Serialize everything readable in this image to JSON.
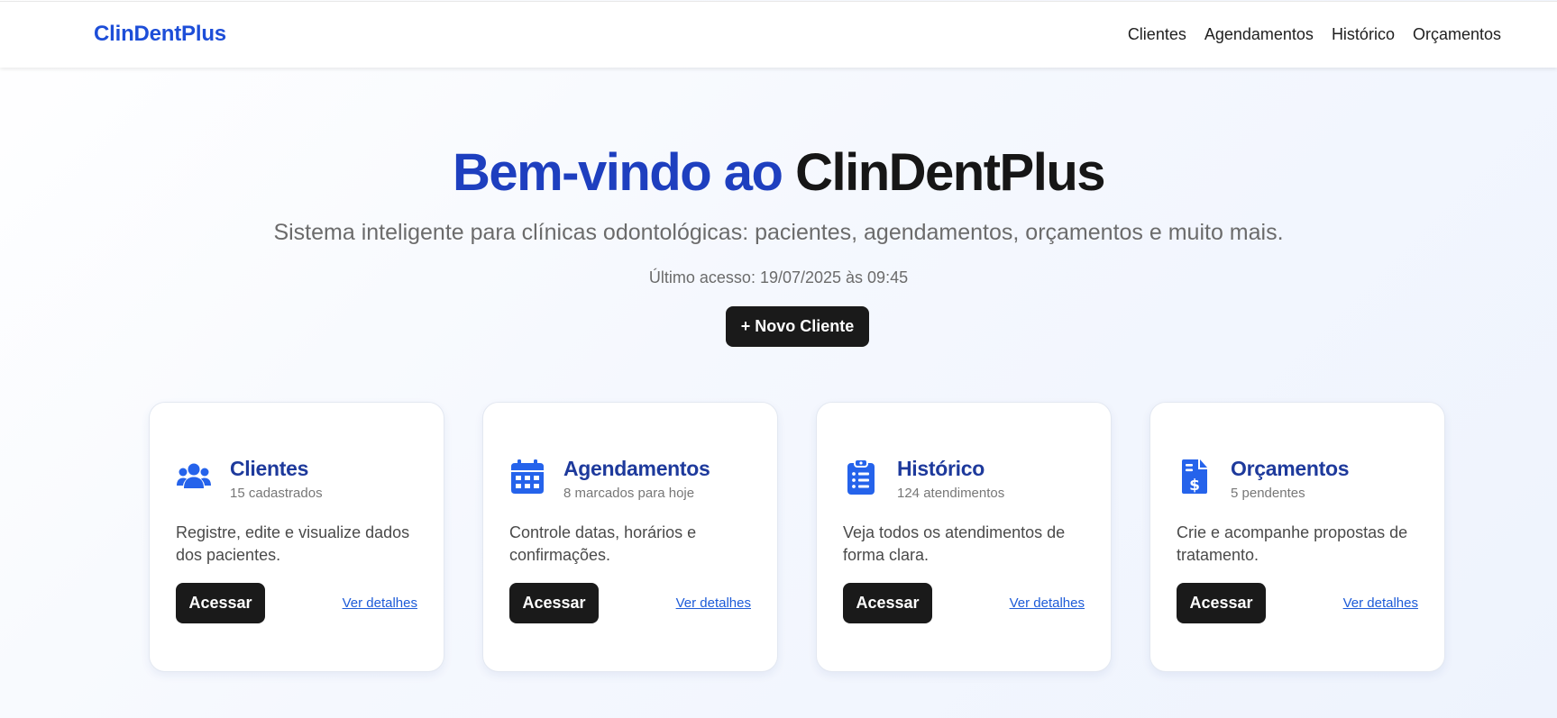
{
  "nav": {
    "brand": "ClinDentPlus",
    "links": [
      "Clientes",
      "Agendamentos",
      "Histórico",
      "Orçamentos"
    ]
  },
  "hero": {
    "title_blue": "Bem-vindo ao",
    "title_dark": "ClinDentPlus",
    "subtitle": "Sistema inteligente para clínicas odontológicas: pacientes, agendamentos, orçamentos e muito mais.",
    "last_access": "Último acesso: 19/07/2025 às 09:45",
    "cta_label": "+ Novo Cliente"
  },
  "cards": [
    {
      "title": "Clientes",
      "count": "15 cadastrados",
      "description": "Registre, edite e visualize dados dos pacientes.",
      "button": "Acessar",
      "link": "Ver detalhes",
      "icon": "users-icon"
    },
    {
      "title": "Agendamentos",
      "count": "8 marcados para hoje",
      "description": "Controle datas, horários e confirmações.",
      "button": "Acessar",
      "link": "Ver detalhes",
      "icon": "calendar-icon"
    },
    {
      "title": "Histórico",
      "count": "124 atendimentos",
      "description": "Veja todos os atendimentos de forma clara.",
      "button": "Acessar",
      "link": "Ver detalhes",
      "icon": "clipboard-list-icon"
    },
    {
      "title": "Orçamentos",
      "count": "5 pendentes",
      "description": "Crie e acompanhe propostas de tratamento.",
      "button": "Acessar",
      "link": "Ver detalhes",
      "icon": "invoice-dollar-icon"
    }
  ],
  "colors": {
    "brand": "#1d4ed8",
    "icon": "#2563eb",
    "card_title": "#1e3a9c",
    "button": "#1a1a1a",
    "link": "#1d5bd8"
  }
}
